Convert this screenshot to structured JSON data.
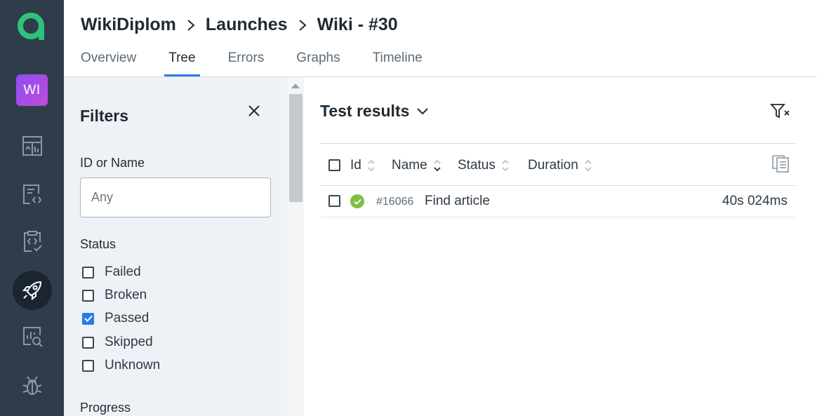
{
  "rail": {
    "project_initials": "WI",
    "items": [
      "dashboard-icon",
      "test-cases-icon",
      "test-plans-icon",
      "launches-icon",
      "analytics-icon",
      "defects-icon"
    ],
    "active_item": "launches-icon",
    "logo_color": "#2ec27e",
    "background": "#2f3d4a"
  },
  "header": {
    "breadcrumb": [
      "WikiDiplom",
      "Launches",
      "Wiki - #30"
    ],
    "tabs": [
      {
        "label": "Overview"
      },
      {
        "label": "Tree",
        "active": true
      },
      {
        "label": "Errors"
      },
      {
        "label": "Graphs"
      },
      {
        "label": "Timeline"
      }
    ]
  },
  "filters": {
    "title": "Filters",
    "id_name_label": "ID or Name",
    "id_name_placeholder": "Any",
    "status_label": "Status",
    "statuses": [
      {
        "label": "Failed",
        "checked": false
      },
      {
        "label": "Broken",
        "checked": false
      },
      {
        "label": "Passed",
        "checked": true
      },
      {
        "label": "Skipped",
        "checked": false
      },
      {
        "label": "Unknown",
        "checked": false
      }
    ],
    "progress_label": "Progress"
  },
  "results": {
    "title": "Test results",
    "columns": [
      "Id",
      "Name",
      "Status",
      "Duration"
    ],
    "rows": [
      {
        "id": "#16066",
        "name": "Find article",
        "status": "passed",
        "duration": "40s 024ms"
      }
    ],
    "accent": "#2b7be6",
    "passed_color": "#7ac143"
  }
}
